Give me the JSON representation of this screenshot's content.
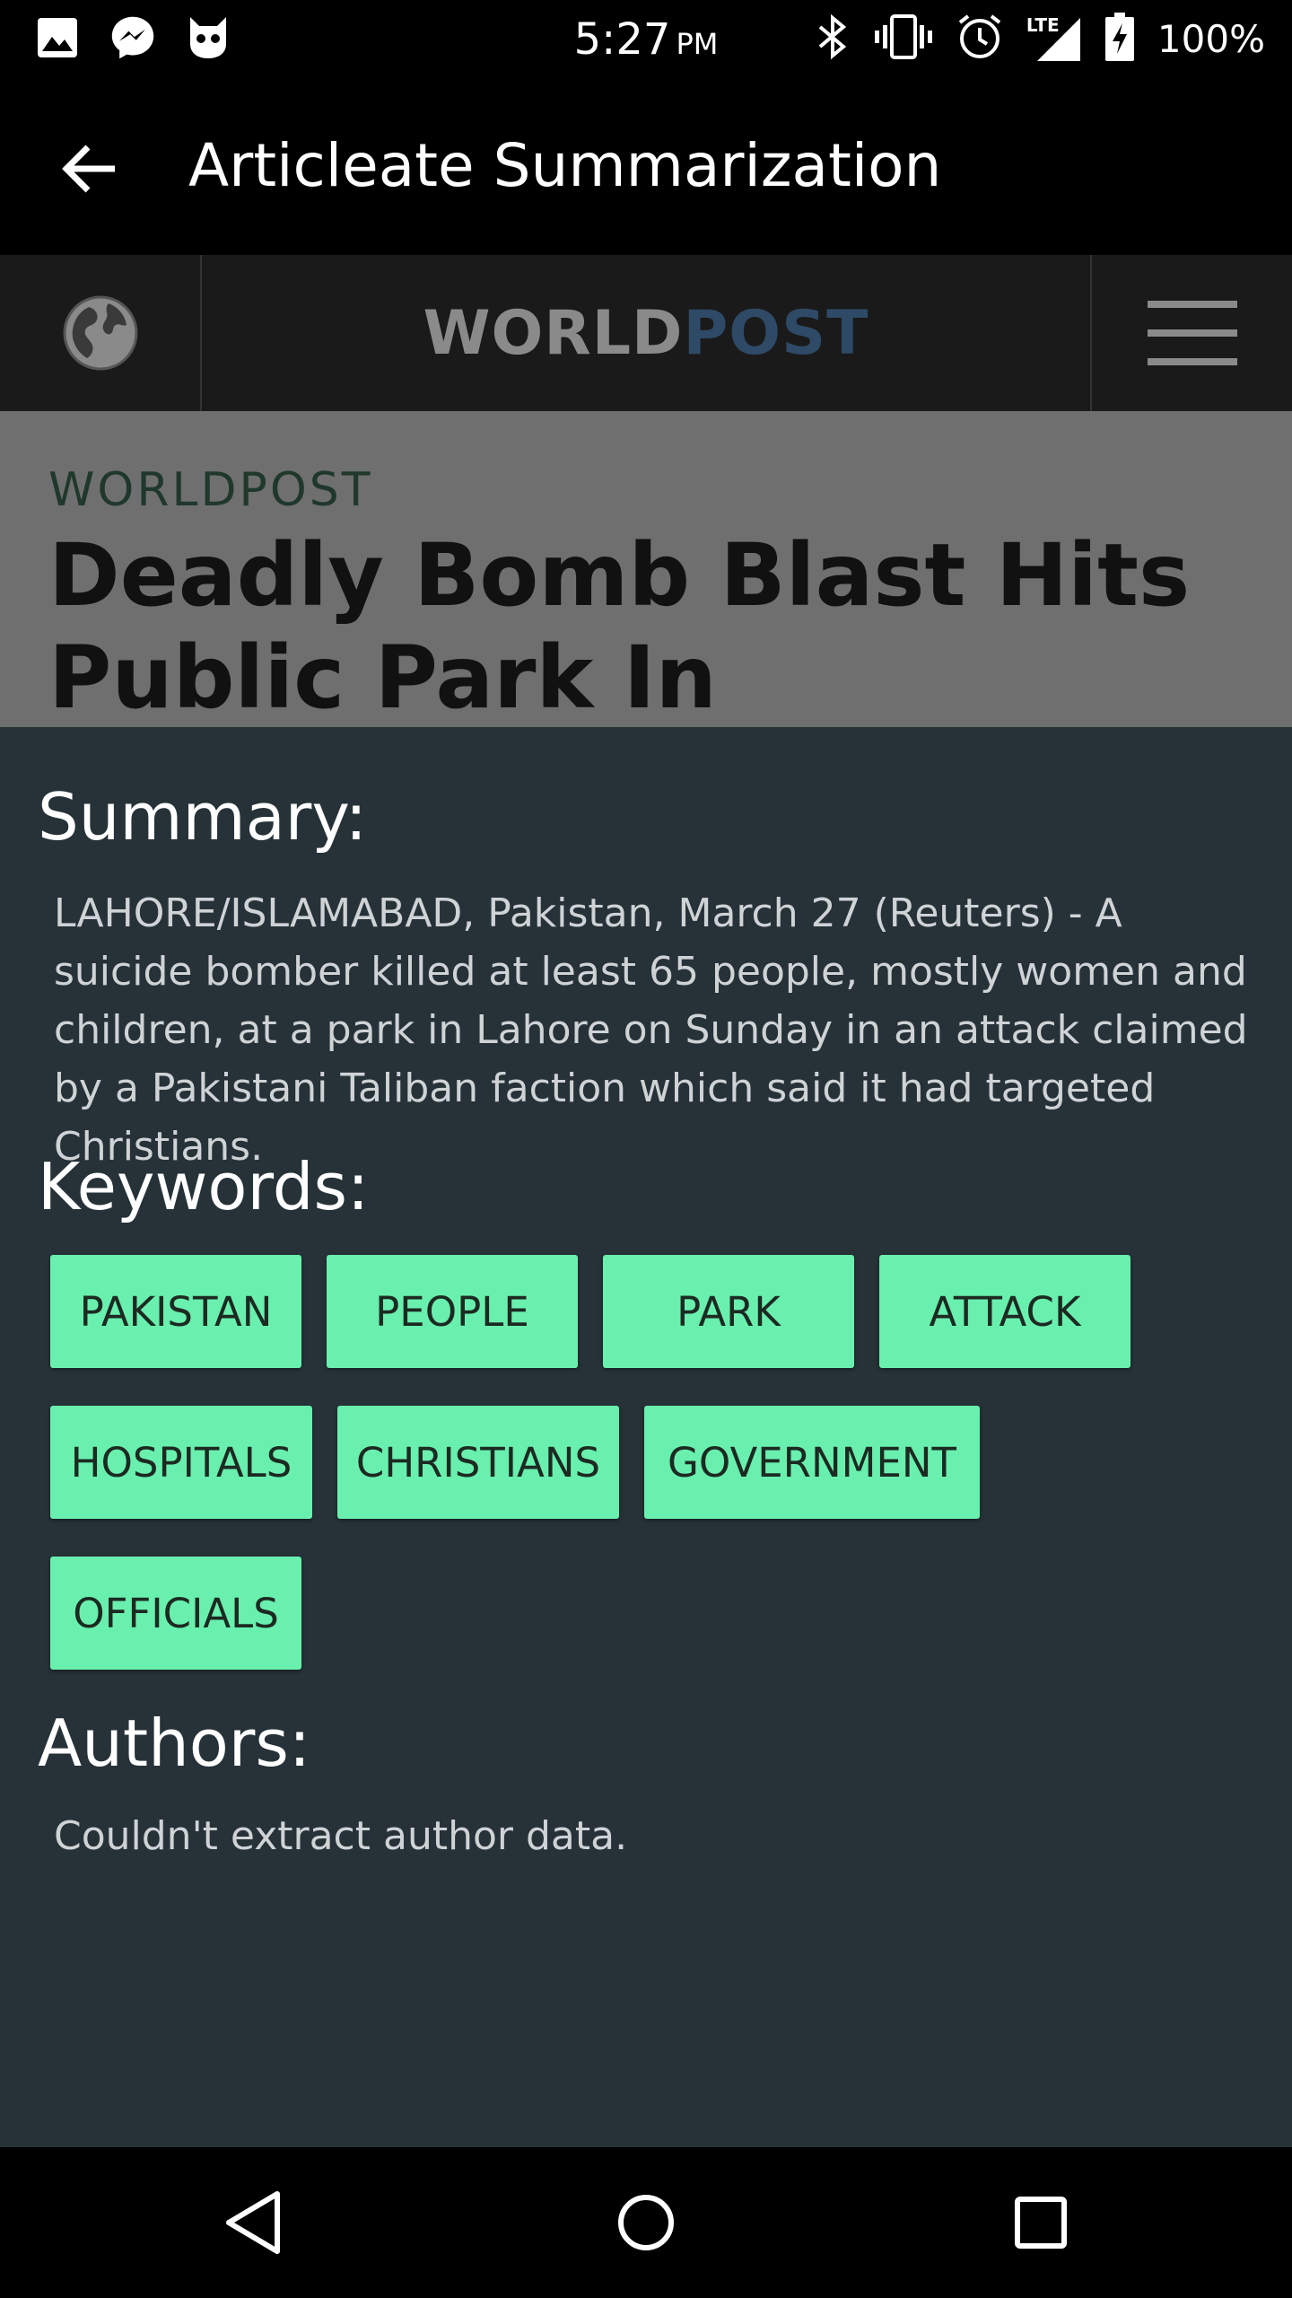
{
  "status_bar": {
    "time": "5:27",
    "ampm": "PM",
    "network": "LTE",
    "battery": "100%",
    "left_icons": [
      "image-icon",
      "messenger-icon",
      "cyanogen-icon"
    ],
    "right_icons": [
      "bluetooth-icon",
      "vibrate-icon",
      "alarm-icon",
      "signal-icon",
      "battery-charging-icon"
    ]
  },
  "app_bar": {
    "title": "Articleate Summarization"
  },
  "webview": {
    "logo_part1": "WORLD",
    "logo_part2": "POST",
    "section": "WORLDPOST",
    "headline": "Deadly Bomb Blast Hits Public Park In Pakistan's"
  },
  "summary": {
    "heading": "Summary:",
    "text": "LAHORE/ISLAMABAD, Pakistan, March 27 (Reuters) - A suicide bomber killed at least 65 people, mostly women and children, at a park in Lahore on Sunday in an attack claimed by a Pakistani Taliban faction which said it had targeted Christians."
  },
  "keywords": {
    "heading": "Keywords:",
    "items": [
      "PAKISTAN",
      "PEOPLE",
      "PARK",
      "ATTACK",
      "HOSPITALS",
      "CHRISTIANS",
      "GOVERNMENT",
      "OFFICIALS"
    ]
  },
  "authors": {
    "heading": "Authors:",
    "text": "Couldn't extract author data."
  },
  "colors": {
    "sheet_bg": "#263238",
    "chip_bg": "#69f0ae",
    "logo_accent": "#2e4a66"
  }
}
